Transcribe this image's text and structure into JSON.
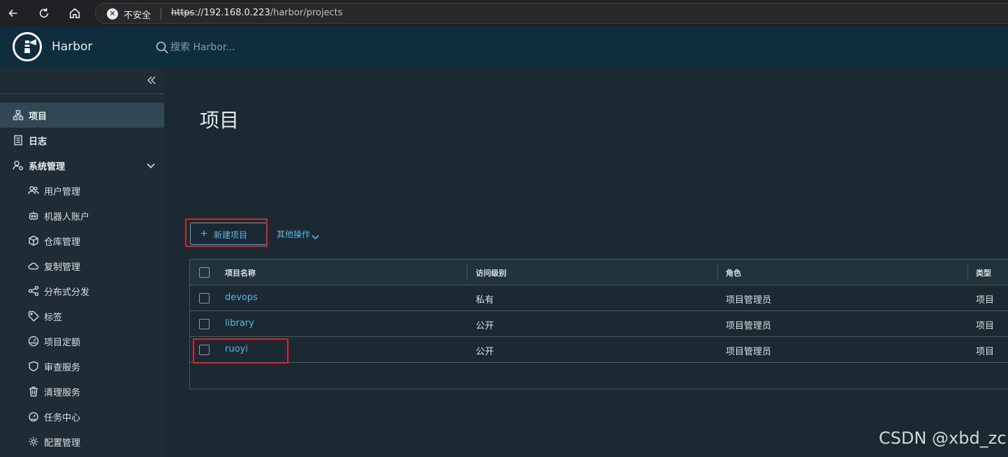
{
  "browser": {
    "insecure_label": "不安全",
    "url_scheme": "https",
    "url_host": "://192.168.0.223",
    "url_path": "/harbor/projects"
  },
  "header": {
    "app_title": "Harbor",
    "search_placeholder": "搜索 Harbor..."
  },
  "sidebar": {
    "items": [
      {
        "label": "项目",
        "icon": "projects-icon",
        "active": true
      },
      {
        "label": "日志",
        "icon": "logs-icon"
      },
      {
        "label": "系统管理",
        "icon": "admin-icon",
        "expanded": true
      }
    ],
    "sub_items": [
      {
        "label": "用户管理",
        "icon": "users-icon"
      },
      {
        "label": "机器人账户",
        "icon": "robot-icon"
      },
      {
        "label": "仓库管理",
        "icon": "registry-icon"
      },
      {
        "label": "复制管理",
        "icon": "replication-icon"
      },
      {
        "label": "分布式分发",
        "icon": "distribution-icon"
      },
      {
        "label": "标签",
        "icon": "tag-icon"
      },
      {
        "label": "项目定额",
        "icon": "quota-icon"
      },
      {
        "label": "审查服务",
        "icon": "shield-icon"
      },
      {
        "label": "清理服务",
        "icon": "trash-icon"
      },
      {
        "label": "任务中心",
        "icon": "task-icon"
      },
      {
        "label": "配置管理",
        "icon": "gear-icon"
      }
    ]
  },
  "main": {
    "title": "项目",
    "new_project_label": "新建项目",
    "other_actions_label": "其他操作",
    "table": {
      "headers": [
        "项目名称",
        "访问级别",
        "角色",
        "类型"
      ],
      "rows": [
        {
          "name": "devops",
          "access": "私有",
          "role": "项目管理员",
          "type": "项目"
        },
        {
          "name": "library",
          "access": "公开",
          "role": "项目管理员",
          "type": "项目"
        },
        {
          "name": "ruoyi",
          "access": "公开",
          "role": "项目管理员",
          "type": "项目"
        }
      ]
    }
  },
  "watermark": "CSDN @xbd_zc",
  "colors": {
    "accent": "#57b8e3",
    "highlight": "#d7252b",
    "header_bg": "#0f2e3d",
    "sidebar_bg": "#1f2c35",
    "main_bg": "#1b2a32"
  }
}
